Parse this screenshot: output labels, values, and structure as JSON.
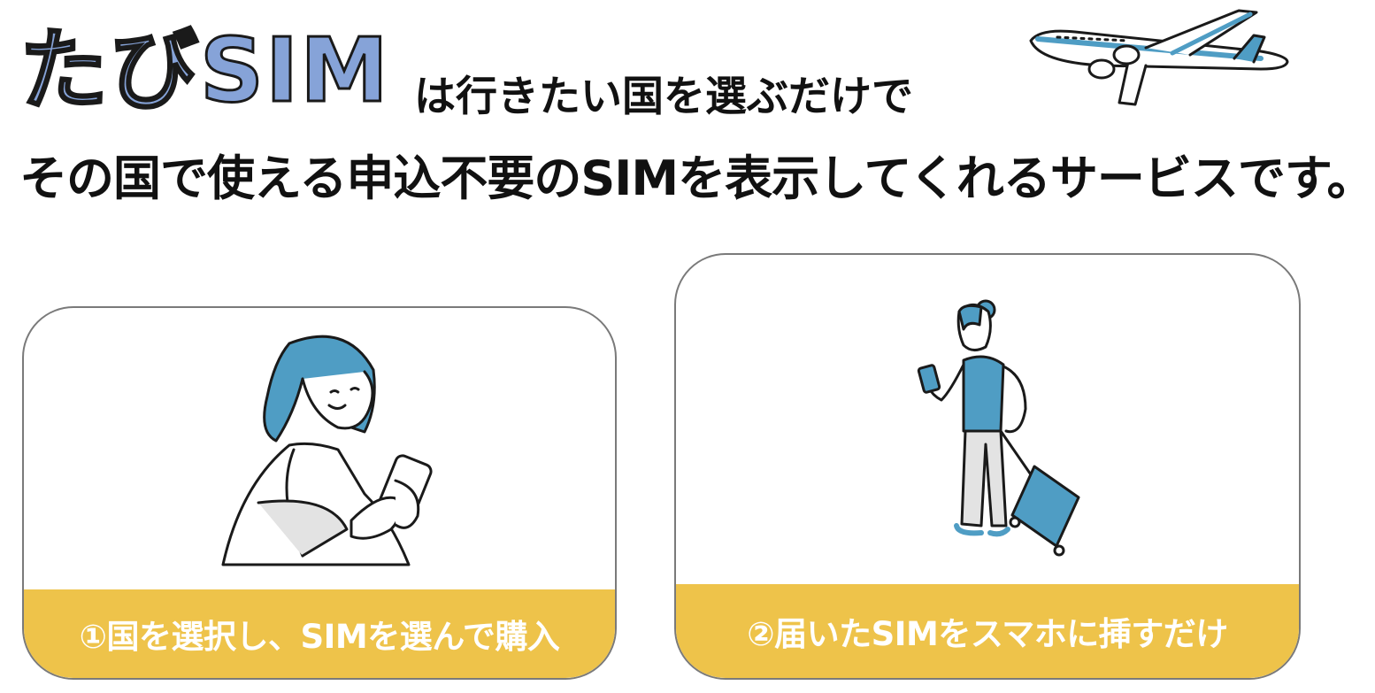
{
  "header": {
    "brand": "たびSIM",
    "headline_line1": "は行きたい国を選ぶだけで",
    "headline_line2": "その国で使える申込不要のSIMを表示してくれるサービスです。"
  },
  "steps": [
    {
      "label": "①国を選択し、SIMを選んで購入"
    },
    {
      "label": "②届いたSIMをスマホに挿すだけ"
    }
  ],
  "colors": {
    "brand_fill": "#86a3d8",
    "accent_yellow": "#eec34a",
    "illustration_blue": "#4f9dc4",
    "outline": "#1a1a1a"
  },
  "icons": [
    "airplane-icon",
    "woman-with-phone-illustration",
    "traveler-with-suitcase-illustration"
  ]
}
